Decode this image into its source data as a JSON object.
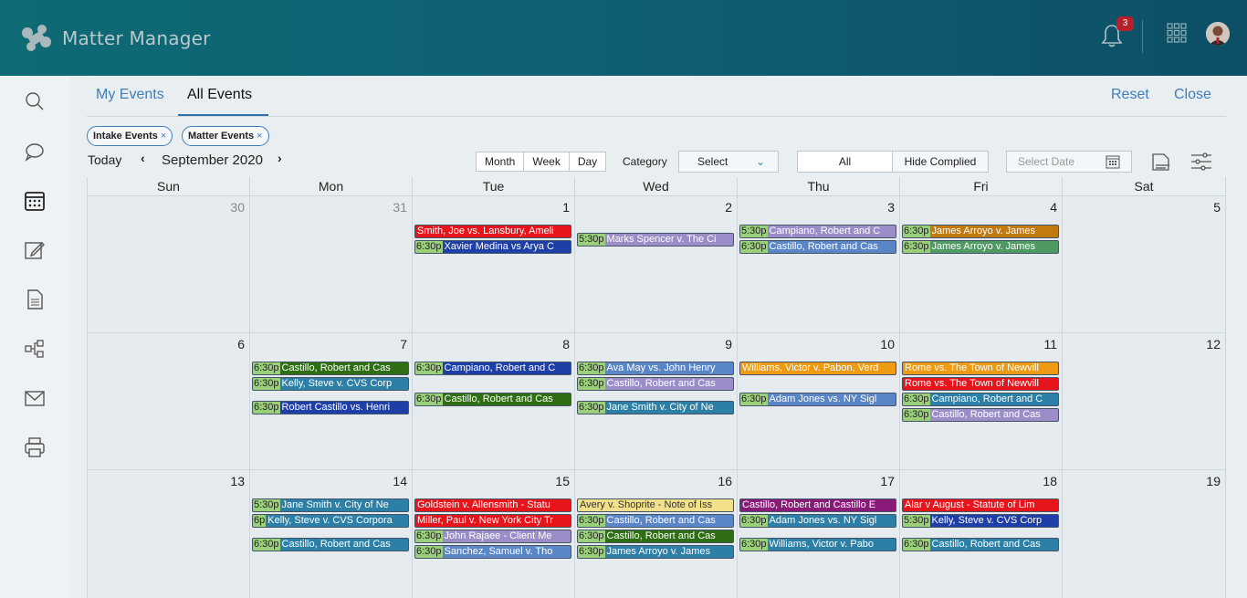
{
  "app": {
    "name": "Matter Manager",
    "notifications": "3"
  },
  "tabs": {
    "my_events": "My Events",
    "all_events": "All Events",
    "reset": "Reset",
    "close": "Close"
  },
  "filters": {
    "chip1": "Intake Events",
    "chip2": "Matter Events",
    "remove": "×"
  },
  "toolbar": {
    "today": "Today",
    "month_label": "September 2020",
    "prev": "‹",
    "next": "›",
    "views": [
      "Month",
      "Week",
      "Day"
    ],
    "category_label": "Category",
    "category_value": "Select",
    "toggle_all": "All",
    "toggle_hide": "Hide Complied",
    "date_placeholder": "Select Date"
  },
  "calendar": {
    "weekdays": [
      "Sun",
      "Mon",
      "Tue",
      "Wed",
      "Thu",
      "Fri",
      "Sat"
    ],
    "weeks": [
      [
        {
          "day": "30",
          "muted": true,
          "events": []
        },
        {
          "day": "31",
          "muted": true,
          "events": []
        },
        {
          "day": "1",
          "events": [
            {
              "time": "",
              "title": "Smith, Joe vs. Lansbury, Ameli",
              "color": "#e8141c",
              "slot": 0
            },
            {
              "time": "6:30p",
              "title": "Xavier Medina vs Arya C",
              "color": "#1f3fa8",
              "slot": 1
            }
          ]
        },
        {
          "day": "2",
          "events": [
            {
              "time": "5:30p",
              "title": "Marks Spencer v. The Ci",
              "color": "#9b8ec8",
              "slot": 0.5
            }
          ]
        },
        {
          "day": "3",
          "events": [
            {
              "time": "5:30p",
              "title": "Campiano, Robert and C",
              "color": "#9b8ec8",
              "slot": 0
            },
            {
              "time": "6:30p",
              "title": "Castillo, Robert and Cas",
              "color": "#5a86c8",
              "slot": 1
            }
          ]
        },
        {
          "day": "4",
          "events": [
            {
              "time": "6:30p",
              "title": "James Arroyo v. James",
              "color": "#c07a10",
              "slot": 0
            },
            {
              "time": "6:30p",
              "title": "James Arroyo v. James",
              "color": "#4f9a62",
              "slot": 1
            }
          ]
        },
        {
          "day": "5",
          "events": []
        }
      ],
      [
        {
          "day": "6",
          "events": []
        },
        {
          "day": "7",
          "events": [
            {
              "time": "6:30p",
              "title": "Castillo, Robert and Cas",
              "color": "#2f6e14",
              "slot": 0
            },
            {
              "time": "6:30p",
              "title": "Kelly, Steve v. CVS Corp",
              "color": "#2c7fa6",
              "slot": 1
            },
            {
              "time": "6:30p",
              "title": "Robert Castillo vs. Henri",
              "color": "#1f3fa8",
              "slot": 2.5
            }
          ]
        },
        {
          "day": "8",
          "events": [
            {
              "time": "6:30p",
              "title": "Campiano, Robert and C",
              "color": "#1f3fa8",
              "slot": 0
            },
            {
              "time": "6:30p",
              "title": "Castillo, Robert and Cas",
              "color": "#2f6e14",
              "slot": 2
            }
          ]
        },
        {
          "day": "9",
          "events": [
            {
              "time": "6:30p",
              "title": "Ava May vs. John Henry",
              "color": "#5a86c8",
              "slot": 0
            },
            {
              "time": "6:30p",
              "title": "Castillo, Robert and Cas",
              "color": "#9b8ec8",
              "slot": 1
            },
            {
              "time": "6:30p",
              "title": "Jane Smith v. City of Ne",
              "color": "#2c7fa6",
              "slot": 2.5
            }
          ]
        },
        {
          "day": "10",
          "events": [
            {
              "time": "",
              "title": "Williams, Victor v. Pabon, Verd",
              "color": "#ee9a12",
              "slot": 0
            },
            {
              "time": "6:30p",
              "title": "Adam Jones vs. NY Sigl",
              "color": "#5a86c8",
              "slot": 2
            }
          ]
        },
        {
          "day": "11",
          "events": [
            {
              "time": "",
              "title": "Rome vs. The Town of Newvill",
              "color": "#ee9a12",
              "slot": 0
            },
            {
              "time": "",
              "title": "Rome vs. The Town of Newvill",
              "color": "#e8141c",
              "slot": 1
            },
            {
              "time": "6:30p",
              "title": "Campiano, Robert and C",
              "color": "#2c7fa6",
              "slot": 2
            },
            {
              "time": "6:30p",
              "title": "Castillo, Robert and Cas",
              "color": "#9b8ec8",
              "slot": 3
            }
          ]
        },
        {
          "day": "12",
          "events": []
        }
      ],
      [
        {
          "day": "13",
          "events": []
        },
        {
          "day": "14",
          "events": [
            {
              "time": "5:30p",
              "title": "Jane Smith v. City of Ne",
              "color": "#2c7fa6",
              "slot": 0
            },
            {
              "time": "6p",
              "title": "Kelly, Steve v. CVS Corpora",
              "color": "#2c7fa6",
              "slot": 1
            },
            {
              "time": "6:30p",
              "title": "Castillo, Robert and Cas",
              "color": "#2c7fa6",
              "slot": 2.5
            }
          ]
        },
        {
          "day": "15",
          "events": [
            {
              "time": "",
              "title": "Goldstein v. Allensmith - Statu",
              "color": "#e8141c",
              "slot": 0
            },
            {
              "time": "",
              "title": "Miller, Paul v. New York City Tr",
              "color": "#e8141c",
              "slot": 1
            },
            {
              "time": "6:30p",
              "title": "John Rajaee - Client Me",
              "color": "#9b8ec8",
              "slot": 2
            },
            {
              "time": "6:30p",
              "title": "Sanchez, Samuel v. Tho",
              "color": "#5a86c8",
              "slot": 3
            }
          ]
        },
        {
          "day": "16",
          "events": [
            {
              "time": "",
              "title": "Avery v. Shoprite - Note of Iss",
              "color": "#f3e08a",
              "text": "#333",
              "slot": 0
            },
            {
              "time": "6:30p",
              "title": "Castillo, Robert and Cas",
              "color": "#5a86c8",
              "slot": 1
            },
            {
              "time": "6:30p",
              "title": "Castillo, Robert and Cas",
              "color": "#2f6e14",
              "slot": 2
            },
            {
              "time": "6:30p",
              "title": "James Arroyo v. James",
              "color": "#2c7fa6",
              "slot": 3
            }
          ]
        },
        {
          "day": "17",
          "events": [
            {
              "time": "",
              "title": "Castillo, Robert and Castillo E",
              "color": "#8a1a7a",
              "slot": 0
            },
            {
              "time": "6:30p",
              "title": "Adam Jones vs. NY Sigl",
              "color": "#2c7fa6",
              "slot": 1
            },
            {
              "time": "6:30p",
              "title": "Williams, Victor v. Pabo",
              "color": "#2c7fa6",
              "slot": 2.5
            }
          ]
        },
        {
          "day": "18",
          "events": [
            {
              "time": "",
              "title": "Alar v August - Statute of Lim",
              "color": "#e8141c",
              "slot": 0
            },
            {
              "time": "5:30p",
              "title": "Kelly, Steve v. CVS Corp",
              "color": "#1f3fa8",
              "slot": 1
            },
            {
              "time": "6:30p",
              "title": "Castillo, Robert and Cas",
              "color": "#2c7fa6",
              "slot": 2.5
            }
          ]
        },
        {
          "day": "19",
          "events": []
        }
      ]
    ]
  },
  "rail_icons": [
    "search-icon",
    "chat-icon",
    "calendar-icon",
    "edit-icon",
    "document-icon",
    "workflow-icon",
    "mail-icon",
    "print-icon"
  ]
}
